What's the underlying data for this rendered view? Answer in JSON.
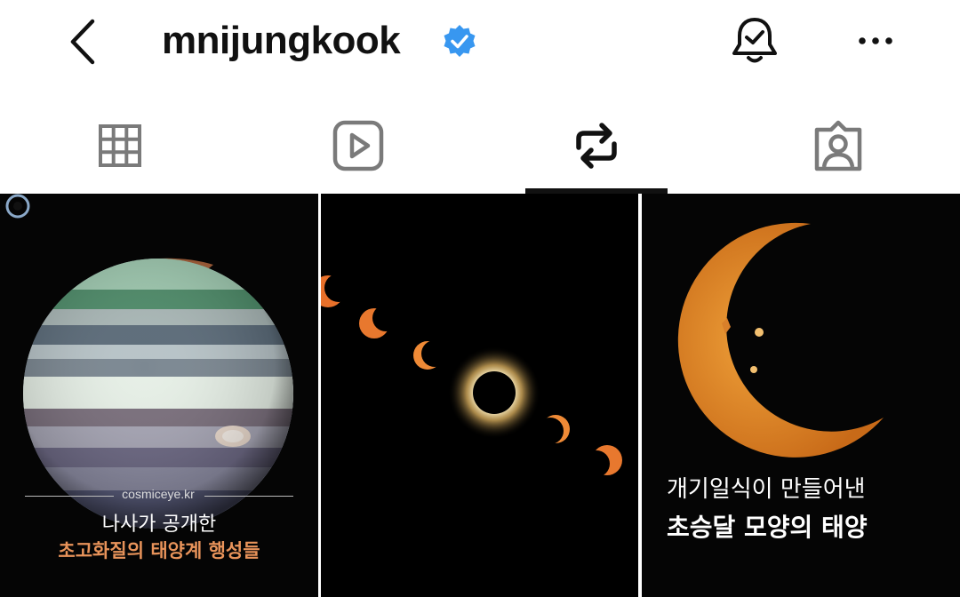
{
  "header": {
    "username": "mnijungkook",
    "icons": [
      "back-arrow-icon",
      "verified-badge-icon",
      "notification-bell-icon",
      "more-options-icon"
    ]
  },
  "tabs": [
    {
      "name": "posts",
      "icon": "grid-icon",
      "active": false
    },
    {
      "name": "reels",
      "icon": "reels-play-icon",
      "active": false
    },
    {
      "name": "reposts",
      "icon": "repost-icon",
      "active": true
    },
    {
      "name": "tagged",
      "icon": "tagged-person-icon",
      "active": false
    }
  ],
  "posts": [
    {
      "credit": "cosmiceye.kr",
      "caption_line1": "나사가 공개한",
      "caption_line2": "초고화질의 태양계 행성들"
    },
    {},
    {
      "caption_line1": "개기일식이 만들어낸",
      "caption_line2": "초승달 모양의 태양"
    }
  ],
  "colors": {
    "verified": "#3897f0",
    "caption_accent": "#e8935a",
    "active_tab": "#111111",
    "inactive_tab": "#7a7a7a"
  }
}
